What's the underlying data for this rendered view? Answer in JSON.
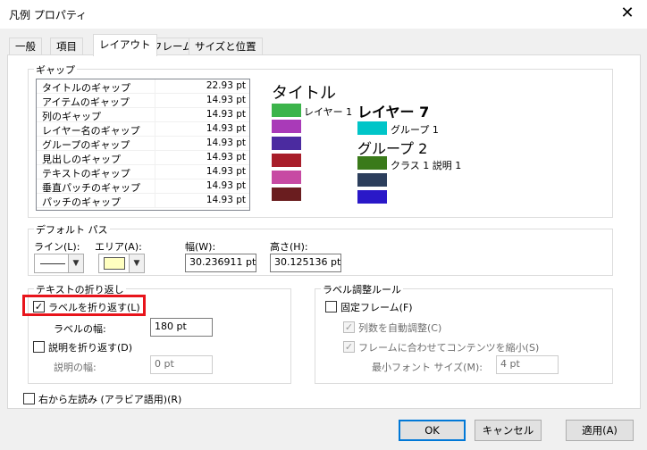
{
  "window": {
    "title": "凡例 プロパティ",
    "close_glyph": "✕"
  },
  "tabs": [
    "一般",
    "項目",
    "レイアウト",
    "フレーム",
    "サイズと位置"
  ],
  "gap": {
    "title": "ギャップ",
    "rows": [
      {
        "name": "タイトルのギャップ",
        "value": "22.93 pt"
      },
      {
        "name": "アイテムのギャップ",
        "value": "14.93 pt"
      },
      {
        "name": "列のギャップ",
        "value": "14.93 pt"
      },
      {
        "name": "レイヤー名のギャップ",
        "value": "14.93 pt"
      },
      {
        "name": "グループのギャップ",
        "value": "14.93 pt"
      },
      {
        "name": "見出しのギャップ",
        "value": "14.93 pt"
      },
      {
        "name": "テキストのギャップ",
        "value": "14.93 pt"
      },
      {
        "name": "垂直パッチのギャップ",
        "value": "14.93 pt"
      },
      {
        "name": "パッチのギャップ",
        "value": "14.93 pt"
      }
    ]
  },
  "preview": {
    "title": "タイトル",
    "layer1": "レイヤー 1",
    "layer7": "レイヤー 7",
    "group1": "グループ 1",
    "group2": "グループ 2",
    "class1": "クラス 1 説明 1",
    "colors": {
      "green": "#3cb44b",
      "purple1": "#a93ab8",
      "purple2": "#4b2ba0",
      "red1": "#a81e2a",
      "pink": "#c74aa3",
      "maroon": "#6a1d1f",
      "teal": "#00c5c8",
      "darkgreen": "#3a7a1a",
      "navy": "#2c3e5c",
      "blue": "#2a18c8"
    }
  },
  "default_path": {
    "title": "デフォルト パス",
    "line_label": "ライン(L):",
    "area_label": "エリア(A):",
    "width_label": "幅(W):",
    "width_value": "30.236911 pt",
    "height_label": "高さ(H):",
    "height_value": "30.125136 pt"
  },
  "wrap": {
    "title": "テキストの折り返し",
    "wrap_label": "ラベルを折り返す(L)",
    "wrap_checked": true,
    "label_width_label": "ラベルの幅:",
    "label_width_value": "180 pt",
    "wrap_desc_label": "説明を折り返す(D)",
    "desc_width_label": "説明の幅:",
    "desc_width_value": "0 pt"
  },
  "fit": {
    "title": "ラベル調整ルール",
    "fixed_frame": "固定フレーム(F)",
    "auto_columns": "列数を自動調整(C)",
    "shrink": "フレームに合わせてコンテンツを縮小(S)",
    "min_font_label": "最小フォント サイズ(M):",
    "min_font_value": "4 pt"
  },
  "rtl_label": "右から左読み (アラビア語用)(R)",
  "buttons": {
    "ok": "OK",
    "cancel": "キャンセル",
    "apply": "適用(A)"
  },
  "check_glyph": "✓"
}
